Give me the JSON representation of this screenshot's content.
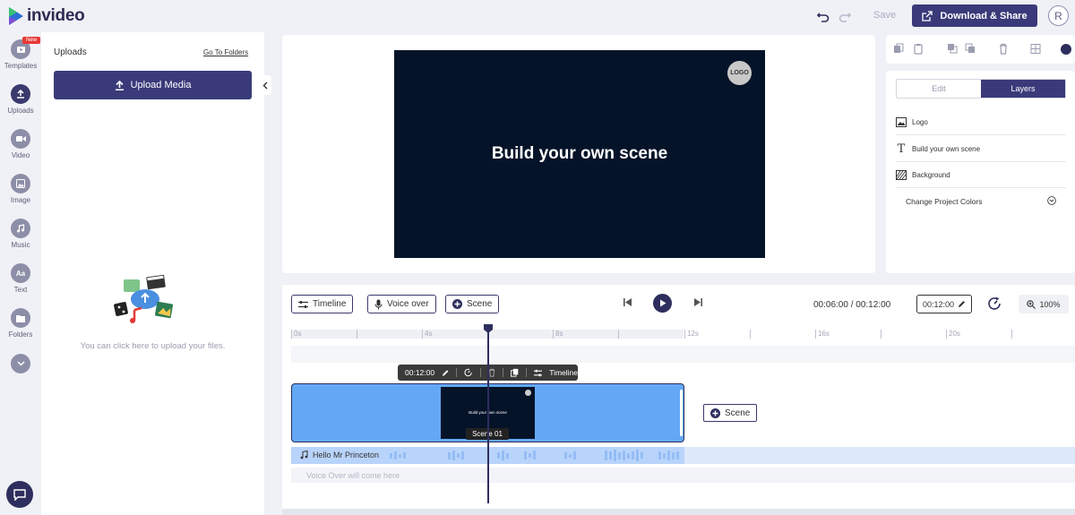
{
  "app": {
    "name": "invideo"
  },
  "topbar": {
    "save_label": "Save",
    "download_label": "Download & Share",
    "avatar_initial": "R"
  },
  "leftnav": {
    "new_badge": "New",
    "items": [
      {
        "label": "Templates",
        "icon": "templates-icon"
      },
      {
        "label": "Uploads",
        "icon": "upload-icon"
      },
      {
        "label": "Video",
        "icon": "video-icon"
      },
      {
        "label": "Image",
        "icon": "image-icon"
      },
      {
        "label": "Music",
        "icon": "music-icon"
      },
      {
        "label": "Text",
        "icon": "text-icon"
      },
      {
        "label": "Folders",
        "icon": "folder-icon"
      }
    ],
    "text_glyph": "Aa"
  },
  "uploads": {
    "title": "Uploads",
    "go_to_folders": "Go To Folders",
    "upload_button": "Upload Media",
    "hint": "You can click here to upload your files."
  },
  "canvas": {
    "logo_text": "LOGO",
    "scene_title": "Build your own scene"
  },
  "right_panel": {
    "tabs": [
      {
        "label": "Edit",
        "active": false
      },
      {
        "label": "Layers",
        "active": true
      }
    ],
    "layers": [
      {
        "label": "Logo",
        "icon": "image-icon"
      },
      {
        "label": "Build your own scene",
        "icon": "text-icon"
      },
      {
        "label": "Background",
        "icon": "background-icon"
      }
    ],
    "project_colors": "Change Project Colors"
  },
  "timeline": {
    "buttons": {
      "timeline": "Timeline",
      "voice_over": "Voice over",
      "scene": "Scene"
    },
    "current_time": "00:06:00",
    "total_time": "00:12:00",
    "time_separator": "/",
    "duration": "00:12:00",
    "zoom": "100%",
    "ruler_ticks": [
      "0s",
      "4s",
      "8s",
      "12s",
      "16s",
      "20s"
    ],
    "scene_toolbar": {
      "duration": "00:12:00",
      "timeline_label": "Timeline"
    },
    "scene_clip": {
      "thumb_text": "Build your own scene",
      "label": "Scene 01"
    },
    "add_scene": "Scene",
    "audio_track": "Hello Mr Princeton",
    "voice_placeholder": "Voice Over will come here"
  },
  "colors": {
    "brand": "#3a3a7a",
    "scene_bg": "#051329",
    "clip_blue": "#64a8f5"
  }
}
